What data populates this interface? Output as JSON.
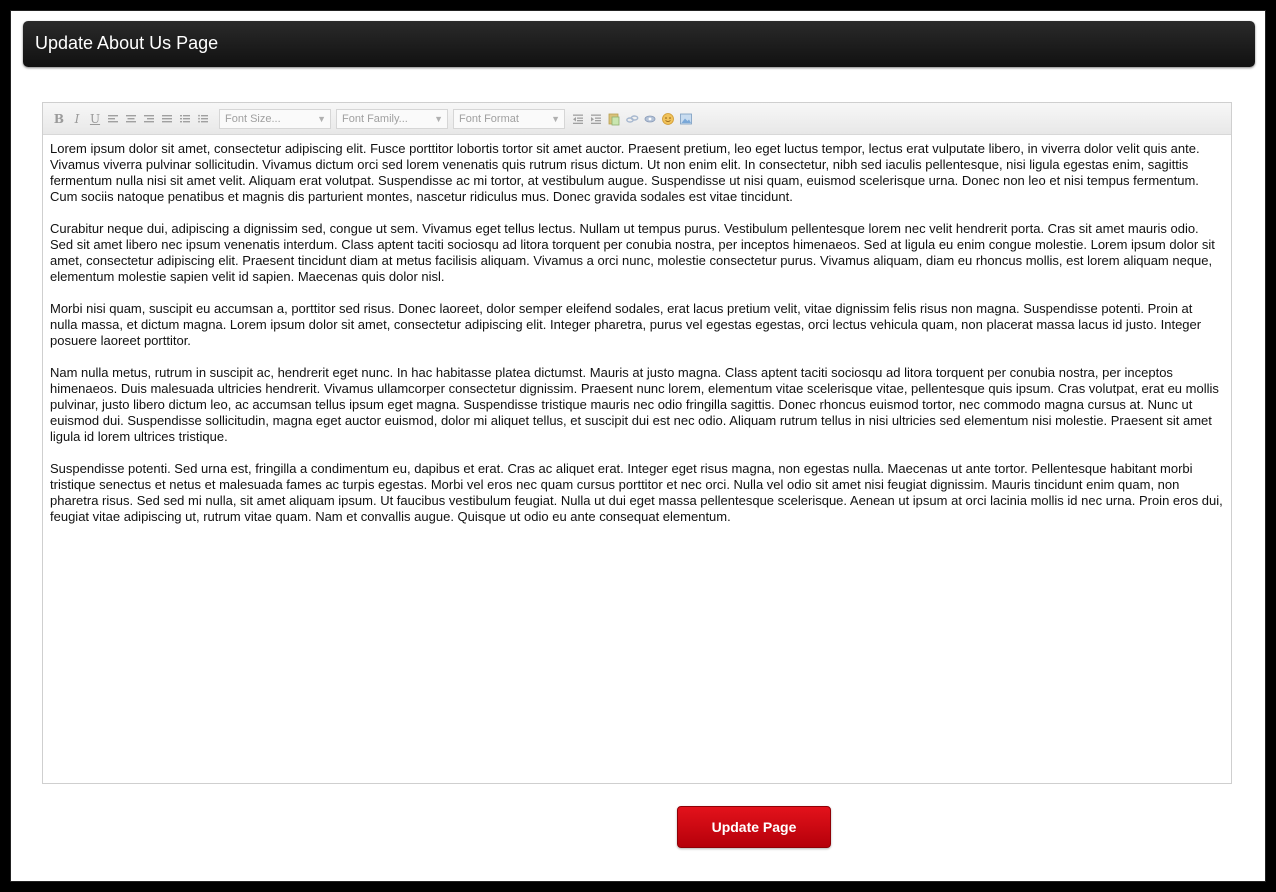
{
  "header": {
    "title": "Update About Us Page"
  },
  "toolbar": {
    "font_size": "Font Size...",
    "font_family": "Font Family...",
    "font_format": "Font Format",
    "icons": [
      "bold-icon",
      "italic-icon",
      "underline-icon",
      "align-left-icon",
      "align-center-icon",
      "align-right-icon",
      "align-justify-icon",
      "ordered-list-icon",
      "unordered-list-icon",
      "outdent-icon",
      "indent-icon",
      "paste-icon",
      "link-icon",
      "unlink-icon",
      "emoticon-icon",
      "image-icon"
    ],
    "labels": {
      "bold": "B",
      "italic": "I",
      "underline": "U"
    }
  },
  "content": {
    "paragraphs": [
      "Lorem ipsum dolor sit amet, consectetur adipiscing elit. Fusce porttitor lobortis tortor sit amet auctor. Praesent pretium, leo eget luctus tempor, lectus erat vulputate libero, in viverra dolor velit quis ante. Vivamus viverra pulvinar sollicitudin. Vivamus dictum orci sed lorem venenatis quis rutrum risus dictum. Ut non enim elit. In consectetur, nibh sed iaculis pellentesque, nisi ligula egestas enim, sagittis fermentum nulla nisi sit amet velit. Aliquam erat volutpat. Suspendisse ac mi tortor, at vestibulum augue. Suspendisse ut nisi quam, euismod scelerisque urna. Donec non leo et nisi tempus fermentum. Cum sociis natoque penatibus et magnis dis parturient montes, nascetur ridiculus mus. Donec gravida sodales est vitae tincidunt.",
      "Curabitur neque dui, adipiscing a dignissim sed, congue ut sem. Vivamus eget tellus lectus. Nullam ut tempus purus. Vestibulum pellentesque lorem nec velit hendrerit porta. Cras sit amet mauris odio. Sed sit amet libero nec ipsum venenatis interdum. Class aptent taciti sociosqu ad litora torquent per conubia nostra, per inceptos himenaeos. Sed at ligula eu enim congue molestie. Lorem ipsum dolor sit amet, consectetur adipiscing elit. Praesent tincidunt diam at metus facilisis aliquam. Vivamus a orci nunc, molestie consectetur purus. Vivamus aliquam, diam eu rhoncus mollis, est lorem aliquam neque, elementum molestie sapien velit id sapien. Maecenas quis dolor nisl.",
      "Morbi nisi quam, suscipit eu accumsan a, porttitor sed risus. Donec laoreet, dolor semper eleifend sodales, erat lacus pretium velit, vitae dignissim felis risus non magna. Suspendisse potenti. Proin at nulla massa, et dictum magna. Lorem ipsum dolor sit amet, consectetur adipiscing elit. Integer pharetra, purus vel egestas egestas, orci lectus vehicula quam, non placerat massa lacus id justo. Integer posuere laoreet porttitor.",
      "Nam nulla metus, rutrum in suscipit ac, hendrerit eget nunc. In hac habitasse platea dictumst. Mauris at justo magna. Class aptent taciti sociosqu ad litora torquent per conubia nostra, per inceptos himenaeos. Duis malesuada ultricies hendrerit. Vivamus ullamcorper consectetur dignissim. Praesent nunc lorem, elementum vitae scelerisque vitae, pellentesque quis ipsum. Cras volutpat, erat eu mollis pulvinar, justo libero dictum leo, ac accumsan tellus ipsum eget magna. Suspendisse tristique mauris nec odio fringilla sagittis. Donec rhoncus euismod tortor, nec commodo magna cursus at. Nunc ut euismod dui. Suspendisse sollicitudin, magna eget auctor euismod, dolor mi aliquet tellus, et suscipit dui est nec odio. Aliquam rutrum tellus in nisi ultricies sed elementum nisi molestie. Praesent sit amet ligula id lorem ultrices tristique.",
      "Suspendisse potenti. Sed urna est, fringilla a condimentum eu, dapibus et erat. Cras ac aliquet erat. Integer eget risus magna, non egestas nulla. Maecenas ut ante tortor. Pellentesque habitant morbi tristique senectus et netus et malesuada fames ac turpis egestas. Morbi vel eros nec quam cursus porttitor et nec orci. Nulla vel odio sit amet nisi feugiat dignissim. Mauris tincidunt enim quam, non pharetra risus. Sed sed mi nulla, sit amet aliquam ipsum. Ut faucibus vestibulum feugiat. Nulla ut dui eget massa pellentesque scelerisque. Aenean ut ipsum at orci lacinia mollis id nec urna. Proin eros dui, feugiat vitae adipiscing ut, rutrum vitae quam. Nam et convallis augue. Quisque ut odio eu ante consequat elementum."
    ]
  },
  "actions": {
    "update_label": "Update Page"
  },
  "colors": {
    "header_bg": "#1a1a1a",
    "button_bg": "#d40a13",
    "toolbar_icon": "#9a9a9a"
  }
}
